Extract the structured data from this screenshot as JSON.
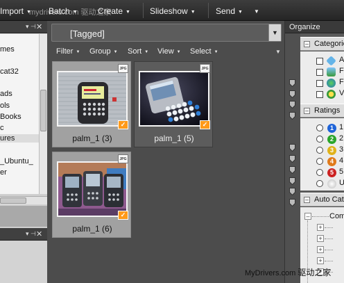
{
  "menubar": {
    "import_label": "Import",
    "batch_label": "Batch",
    "create_label": "Create",
    "slideshow_label": "Slideshow",
    "send_label": "Send",
    "watermark": "mydrivers.com 驱动之家"
  },
  "folder_pane": {
    "items": [
      "mes",
      "cat32",
      "ads",
      "ols",
      "Books",
      "c",
      "ures",
      "_Ubuntu_",
      "er"
    ]
  },
  "center": {
    "view_combo_value": "[Tagged]",
    "toolbar": {
      "filter": "Filter",
      "group": "Group",
      "sort": "Sort",
      "view": "View",
      "select": "Select"
    },
    "thumbnails": [
      {
        "label": "palm_1 (3)",
        "badge": "JPG",
        "selected": true
      },
      {
        "label": "palm_1 (5)",
        "badge": "JPG",
        "selected": false
      },
      {
        "label": "palm_1 (6)",
        "badge": "JPG",
        "selected": true
      }
    ]
  },
  "organize": {
    "title": "Organize",
    "categories": {
      "label": "Categorie",
      "items": [
        "A",
        "F",
        "F",
        "V"
      ]
    },
    "ratings": {
      "label": "Ratings",
      "items": [
        {
          "num": "1",
          "text": "1",
          "color": "#1e63d8"
        },
        {
          "num": "2",
          "text": "2",
          "color": "#2aa52a"
        },
        {
          "num": "3",
          "text": "3",
          "color": "#e0b21a"
        },
        {
          "num": "4",
          "text": "4",
          "color": "#e07a1a"
        },
        {
          "num": "5",
          "text": "5",
          "color": "#cc2222"
        },
        {
          "num": "",
          "text": "U",
          "color": "#bcbcbc"
        }
      ]
    },
    "auto_categories": {
      "label": "Auto Cat",
      "root": "Com"
    }
  },
  "watermark": {
    "latin": "MyDrivers.com",
    "cn": "驱动之家"
  },
  "colors": {
    "accent_orange": "#ff9a1a",
    "panel_dark": "#4c4c4c",
    "selected_thumb": "#a1a1a1"
  }
}
